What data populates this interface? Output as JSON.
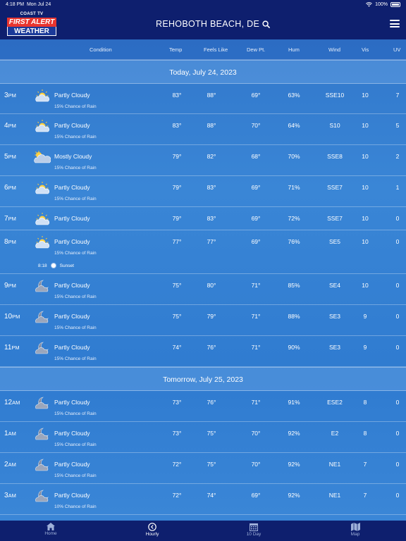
{
  "status": {
    "time": "4:18 PM",
    "date": "Mon Jul 24",
    "battery": "100%"
  },
  "header": {
    "brand": "COAST TV",
    "brand_line1": "FIRST ALERT",
    "brand_line2": "WEATHER",
    "location": "REHOBOTH BEACH, DE"
  },
  "columns": {
    "condition": "Condition",
    "temp": "Temp",
    "feels_like": "Feels Like",
    "dew": "Dew Pt.",
    "hum": "Hum",
    "wind": "Wind",
    "vis": "Vis",
    "uv": "UV"
  },
  "sections": {
    "today": "Today, July 24, 2023",
    "tomorrow": "Tomorrow, July 25, 2023"
  },
  "rows": [
    {
      "hour": "3",
      "ampm": "PM",
      "icon": "partly-cloudy-day-icon",
      "cond": "Partly Cloudy",
      "rain": "15% Chance of Rain",
      "temp": "83°",
      "feels": "88°",
      "dew": "69°",
      "hum": "63%",
      "wind": "SSE10",
      "vis": "10",
      "uv": "7"
    },
    {
      "hour": "4",
      "ampm": "PM",
      "icon": "partly-cloudy-day-icon",
      "cond": "Partly Cloudy",
      "rain": "15% Chance of Rain",
      "temp": "83°",
      "feels": "88°",
      "dew": "70°",
      "hum": "64%",
      "wind": "S10",
      "vis": "10",
      "uv": "5"
    },
    {
      "hour": "5",
      "ampm": "PM",
      "icon": "mostly-cloudy-day-icon",
      "cond": "Mostly Cloudy",
      "rain": "15% Chance of Rain",
      "temp": "79°",
      "feels": "82°",
      "dew": "68°",
      "hum": "70%",
      "wind": "SSE8",
      "vis": "10",
      "uv": "2"
    },
    {
      "hour": "6",
      "ampm": "PM",
      "icon": "partly-cloudy-day-icon",
      "cond": "Partly Cloudy",
      "rain": "15% Chance of Rain",
      "temp": "79°",
      "feels": "83°",
      "dew": "69°",
      "hum": "71%",
      "wind": "SSE7",
      "vis": "10",
      "uv": "1"
    },
    {
      "hour": "7",
      "ampm": "PM",
      "icon": "partly-cloudy-day-icon",
      "cond": "Partly Cloudy",
      "rain": "",
      "temp": "79°",
      "feels": "83°",
      "dew": "69°",
      "hum": "72%",
      "wind": "SSE7",
      "vis": "10",
      "uv": "0"
    },
    {
      "hour": "8",
      "ampm": "PM",
      "icon": "partly-cloudy-day-icon",
      "cond": "Partly Cloudy",
      "rain": "15% Chance of Rain",
      "temp": "77°",
      "feels": "77°",
      "dew": "69°",
      "hum": "76%",
      "wind": "SE5",
      "vis": "10",
      "uv": "0",
      "sunset_time": "8:18",
      "sunset_label": "Sunset"
    },
    {
      "hour": "9",
      "ampm": "PM",
      "icon": "partly-cloudy-night-icon",
      "cond": "Partly Cloudy",
      "rain": "15% Chance of Rain",
      "temp": "75°",
      "feels": "80°",
      "dew": "71°",
      "hum": "85%",
      "wind": "SE4",
      "vis": "10",
      "uv": "0"
    },
    {
      "hour": "10",
      "ampm": "PM",
      "icon": "partly-cloudy-night-icon",
      "cond": "Partly Cloudy",
      "rain": "15% Chance of Rain",
      "temp": "75°",
      "feels": "79°",
      "dew": "71°",
      "hum": "88%",
      "wind": "SE3",
      "vis": "9",
      "uv": "0"
    },
    {
      "hour": "11",
      "ampm": "PM",
      "icon": "partly-cloudy-night-icon",
      "cond": "Partly Cloudy",
      "rain": "15% Chance of Rain",
      "temp": "74°",
      "feels": "76°",
      "dew": "71°",
      "hum": "90%",
      "wind": "SE3",
      "vis": "9",
      "uv": "0"
    },
    {
      "hour": "12",
      "ampm": "AM",
      "icon": "partly-cloudy-night-icon",
      "cond": "Partly Cloudy",
      "rain": "15% Chance of Rain",
      "temp": "73°",
      "feels": "76°",
      "dew": "71°",
      "hum": "91%",
      "wind": "ESE2",
      "vis": "8",
      "uv": "0"
    },
    {
      "hour": "1",
      "ampm": "AM",
      "icon": "partly-cloudy-night-icon",
      "cond": "Partly Cloudy",
      "rain": "15% Chance of Rain",
      "temp": "73°",
      "feels": "75°",
      "dew": "70°",
      "hum": "92%",
      "wind": "E2",
      "vis": "8",
      "uv": "0"
    },
    {
      "hour": "2",
      "ampm": "AM",
      "icon": "partly-cloudy-night-icon",
      "cond": "Partly Cloudy",
      "rain": "15% Chance of Rain",
      "temp": "72°",
      "feels": "75°",
      "dew": "70°",
      "hum": "92%",
      "wind": "NE1",
      "vis": "7",
      "uv": "0"
    },
    {
      "hour": "3",
      "ampm": "AM",
      "icon": "partly-cloudy-night-icon",
      "cond": "Partly Cloudy",
      "rain": "10% Chance of Rain",
      "temp": "72°",
      "feels": "74°",
      "dew": "69°",
      "hum": "92%",
      "wind": "NE1",
      "vis": "7",
      "uv": "0"
    }
  ],
  "tabs": [
    {
      "label": "Home",
      "icon": "home-icon",
      "active": false
    },
    {
      "label": "Hourly",
      "icon": "hourly-icon",
      "active": true
    },
    {
      "label": "10 Day",
      "icon": "calendar-icon",
      "active": false
    },
    {
      "label": "Map",
      "icon": "map-icon",
      "active": false
    }
  ]
}
